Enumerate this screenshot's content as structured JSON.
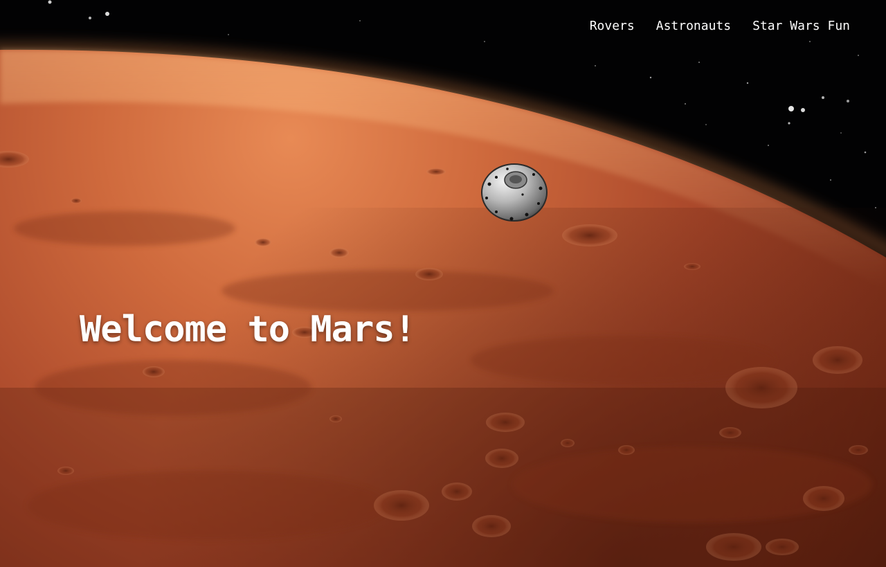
{
  "nav": {
    "items": [
      {
        "label": "Rovers"
      },
      {
        "label": "Astronauts"
      },
      {
        "label": "Star Wars Fun"
      }
    ]
  },
  "hero": {
    "title": "Welcome to Mars!"
  },
  "colors": {
    "space": "#020203",
    "mars_light": "#f2a36a",
    "mars_mid": "#c25a33",
    "mars_dark": "#6e2714",
    "atmosphere_glow": "#ffb070",
    "text": "#ffffff"
  },
  "imagery": {
    "background": "mars-planet-surface",
    "capsule": "landing-capsule-icon"
  }
}
